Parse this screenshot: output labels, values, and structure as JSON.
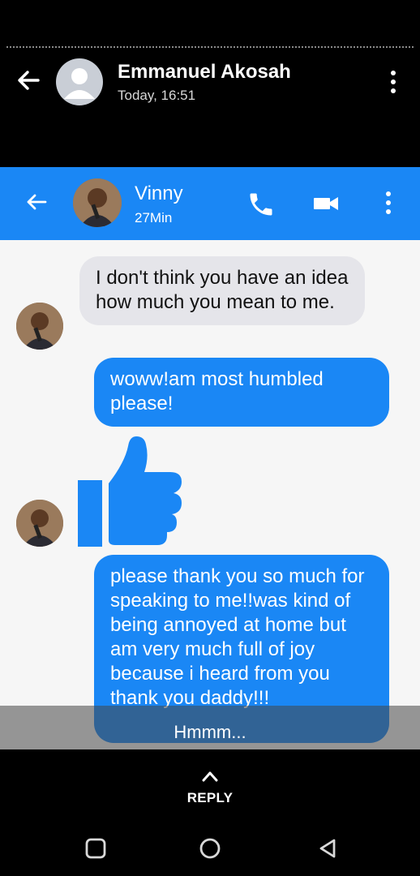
{
  "viewer": {
    "sender_name": "Emmanuel Akosah",
    "timestamp": "Today, 16:51"
  },
  "messenger": {
    "contact_name": "Vinny",
    "contact_status": "27Min",
    "accent_color": "#1a87f5",
    "icons": [
      "back-arrow-icon",
      "phone-icon",
      "video-camera-icon",
      "more-vertical-icon"
    ]
  },
  "messages": [
    {
      "direction": "incoming",
      "text": "I don't think you have an idea how much you mean to me."
    },
    {
      "direction": "outgoing",
      "text": "woww!am most humbled please!"
    },
    {
      "direction": "incoming",
      "type": "sticker",
      "icon": "thumbs-up-icon"
    },
    {
      "direction": "outgoing",
      "text": "please thank you so much for speaking to me!!was kind of being annoyed at home but am very much full of joy because i heard from you\nthank you daddy!!!"
    }
  ],
  "caption": "Hmmm...",
  "reply": {
    "label": "REPLY"
  }
}
